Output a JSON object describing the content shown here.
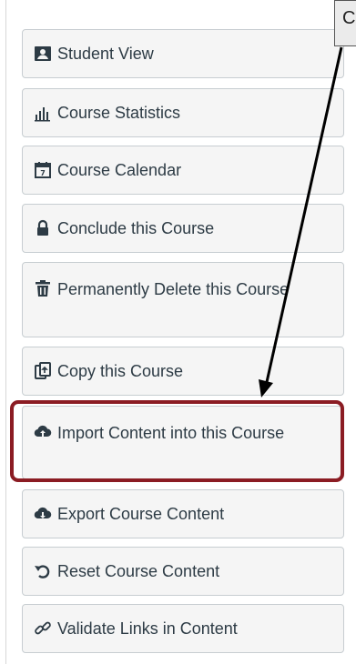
{
  "sidebar": {
    "buttons": [
      {
        "label": "Student View",
        "icon": "student-view-icon"
      },
      {
        "label": "Course Statistics",
        "icon": "bar-chart-icon"
      },
      {
        "label": "Course Calendar",
        "icon": "calendar-icon"
      },
      {
        "label": "Conclude this Course",
        "icon": "lock-icon"
      },
      {
        "label": "Permanently Delete this Course",
        "icon": "trash-icon"
      },
      {
        "label": "Copy this Course",
        "icon": "copy-icon"
      },
      {
        "label": "Import Content into this Course",
        "icon": "cloud-upload-icon"
      },
      {
        "label": "Export Course Content",
        "icon": "cloud-download-icon"
      },
      {
        "label": "Reset Course Content",
        "icon": "reset-icon"
      },
      {
        "label": "Validate Links in Content",
        "icon": "link-icon"
      }
    ]
  },
  "callout": {
    "text": "C"
  },
  "colors": {
    "highlight": "#8b1c23",
    "button_bg": "#f5f5f5",
    "button_text": "#2d3b45"
  }
}
